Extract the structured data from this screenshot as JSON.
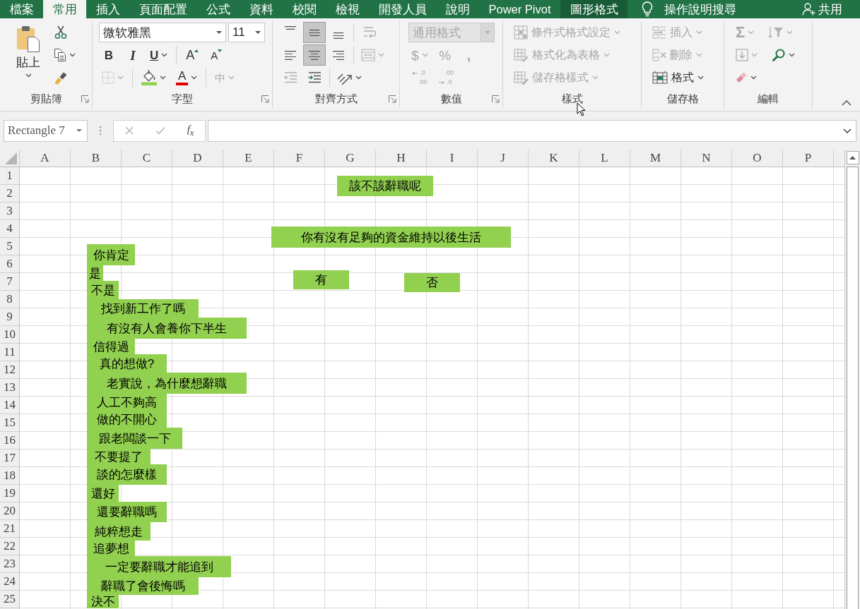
{
  "menu_bar": {
    "tabs": [
      {
        "label": "檔案",
        "kind": "standard",
        "selected": false
      },
      {
        "label": "常用",
        "kind": "standard",
        "selected": true
      },
      {
        "label": "插入",
        "kind": "standard",
        "selected": false
      },
      {
        "label": "頁面配置",
        "kind": "standard",
        "selected": false
      },
      {
        "label": "公式",
        "kind": "standard",
        "selected": false
      },
      {
        "label": "資料",
        "kind": "standard",
        "selected": false
      },
      {
        "label": "校閱",
        "kind": "standard",
        "selected": false
      },
      {
        "label": "檢視",
        "kind": "standard",
        "selected": false
      },
      {
        "label": "開發人員",
        "kind": "standard",
        "selected": false
      },
      {
        "label": "說明",
        "kind": "standard",
        "selected": false
      },
      {
        "label": "Power Pivot",
        "kind": "standard",
        "selected": false
      },
      {
        "label": "圖形格式",
        "kind": "contextual",
        "selected": false
      }
    ],
    "search_label": "操作說明搜尋",
    "share_label": "共用"
  },
  "ribbon": {
    "groups": [
      {
        "kind": "clipboard",
        "label": "剪貼簿",
        "launcher": true,
        "large": {
          "kind": "paste",
          "label": "貼上",
          "caret": true,
          "disabled": false
        },
        "rows": [
          {
            "segments": [
              {
                "tools": [
                  {
                    "kind": "cut",
                    "caret": false,
                    "disabled": false
                  }
                ]
              }
            ]
          },
          {
            "segments": [
              {
                "tools": [
                  {
                    "kind": "copy",
                    "caret": true,
                    "disabled": false
                  }
                ]
              }
            ]
          },
          {
            "segments": [
              {
                "tools": [
                  {
                    "kind": "format-painter",
                    "caret": false,
                    "disabled": false
                  }
                ]
              }
            ]
          }
        ]
      },
      {
        "kind": "font",
        "label": "字型",
        "launcher": true,
        "rows": [
          {
            "segments": [
              {
                "tools": [
                  {
                    "kind": "font-name",
                    "value": "微软雅黑",
                    "disabled": false
                  },
                  {
                    "kind": "font-size",
                    "value": "11",
                    "disabled": false
                  }
                ]
              }
            ]
          },
          {
            "segments": [
              {
                "tools": [
                  {
                    "kind": "bold",
                    "glyph": "B",
                    "caret": false,
                    "disabled": false
                  },
                  {
                    "kind": "italic",
                    "glyph": "I",
                    "caret": false,
                    "disabled": false
                  },
                  {
                    "kind": "underline",
                    "glyph": "U",
                    "caret": true,
                    "disabled": false
                  }
                ]
              },
              {
                "tools": [
                  {
                    "kind": "grow-font",
                    "glyph": "A",
                    "caret": false,
                    "disabled": false
                  },
                  {
                    "kind": "shrink-font",
                    "glyph": "A",
                    "caret": false,
                    "disabled": false
                  }
                ]
              }
            ]
          },
          {
            "segments": [
              {
                "tools": [
                  {
                    "kind": "borders",
                    "caret": true,
                    "disabled": true
                  }
                ]
              },
              {
                "tools": [
                  {
                    "kind": "fill-color",
                    "caret": true,
                    "disabled": false
                  },
                  {
                    "kind": "font-color",
                    "glyph": "A",
                    "caret": true,
                    "disabled": false
                  }
                ]
              },
              {
                "tools": [
                  {
                    "kind": "phonetic",
                    "glyph": "中",
                    "caret": true,
                    "disabled": true
                  }
                ]
              }
            ]
          }
        ]
      },
      {
        "kind": "alignment",
        "label": "對齊方式",
        "launcher": true,
        "rows": [
          {
            "segments": [
              {
                "tools": [
                  {
                    "kind": "align-top",
                    "caret": false,
                    "disabled": false,
                    "selected": false
                  },
                  {
                    "kind": "align-middle",
                    "caret": false,
                    "disabled": false,
                    "selected": true
                  },
                  {
                    "kind": "align-bottom",
                    "caret": false,
                    "disabled": false,
                    "selected": false
                  }
                ]
              },
              {
                "tools": [
                  {
                    "kind": "wrap-text",
                    "caret": false,
                    "disabled": true
                  }
                ]
              }
            ]
          },
          {
            "segments": [
              {
                "tools": [
                  {
                    "kind": "align-left",
                    "caret": false,
                    "disabled": false,
                    "selected": false
                  },
                  {
                    "kind": "align-center",
                    "caret": false,
                    "disabled": false,
                    "selected": true
                  },
                  {
                    "kind": "align-right",
                    "caret": false,
                    "disabled": false,
                    "selected": false
                  }
                ]
              },
              {
                "tools": [
                  {
                    "kind": "merge",
                    "caret": true,
                    "disabled": true
                  }
                ]
              }
            ]
          },
          {
            "segments": [
              {
                "tools": [
                  {
                    "kind": "decrease-indent",
                    "caret": false,
                    "disabled": true
                  },
                  {
                    "kind": "increase-indent",
                    "caret": false,
                    "disabled": false
                  }
                ]
              },
              {
                "tools": [
                  {
                    "kind": "orientation",
                    "caret": true,
                    "disabled": false
                  }
                ]
              }
            ]
          }
        ]
      },
      {
        "kind": "number",
        "label": "數值",
        "launcher": true,
        "rows": [
          {
            "segments": [
              {
                "tools": [
                  {
                    "kind": "number-format",
                    "value": "通用格式",
                    "disabled": true
                  }
                ]
              }
            ]
          },
          {
            "segments": [
              {
                "tools": [
                  {
                    "kind": "currency",
                    "glyph": "$",
                    "caret": true,
                    "disabled": true
                  },
                  {
                    "kind": "percent",
                    "glyph": "%",
                    "caret": false,
                    "disabled": true
                  },
                  {
                    "kind": "comma",
                    "glyph": ",",
                    "caret": false,
                    "disabled": true
                  }
                ]
              }
            ]
          },
          {
            "segments": [
              {
                "tools": [
                  {
                    "kind": "increase-decimal",
                    "lines": [
                      ".0",
                      ".00"
                    ],
                    "caret": false,
                    "disabled": true
                  },
                  {
                    "kind": "decrease-decimal",
                    "lines": [
                      ".00",
                      ".0"
                    ],
                    "caret": false,
                    "disabled": true
                  }
                ]
              }
            ]
          }
        ]
      },
      {
        "kind": "styles",
        "label": "樣式",
        "launcher": false,
        "rows": [
          {
            "segments": [
              {
                "tools": [
                  {
                    "kind": "conditional-format",
                    "label": "條件式格式設定",
                    "caret": true,
                    "disabled": true
                  }
                ]
              }
            ]
          },
          {
            "segments": [
              {
                "tools": [
                  {
                    "kind": "format-as-table",
                    "label": "格式化為表格",
                    "caret": true,
                    "disabled": true
                  }
                ]
              }
            ]
          },
          {
            "segments": [
              {
                "tools": [
                  {
                    "kind": "cell-styles",
                    "label": "儲存格樣式",
                    "caret": true,
                    "disabled": true
                  }
                ]
              }
            ]
          }
        ]
      },
      {
        "kind": "cells",
        "label": "儲存格",
        "launcher": false,
        "rows": [
          {
            "segments": [
              {
                "tools": [
                  {
                    "kind": "insert-cells",
                    "label": "插入",
                    "caret": true,
                    "disabled": true
                  }
                ]
              }
            ]
          },
          {
            "segments": [
              {
                "tools": [
                  {
                    "kind": "delete-cells",
                    "label": "刪除",
                    "caret": true,
                    "disabled": true
                  }
                ]
              }
            ]
          },
          {
            "segments": [
              {
                "tools": [
                  {
                    "kind": "format-cells",
                    "label": "格式",
                    "caret": true,
                    "disabled": false
                  }
                ]
              }
            ]
          }
        ]
      },
      {
        "kind": "editing",
        "label": "編輯",
        "launcher": false,
        "rows": [
          {
            "segments": [
              {
                "tools": [
                  {
                    "kind": "autosum",
                    "glyph": "Σ",
                    "caret": true,
                    "disabled": true
                  },
                  {
                    "kind": "sort-filter",
                    "caret": true,
                    "disabled": true
                  }
                ]
              }
            ]
          },
          {
            "segments": [
              {
                "tools": [
                  {
                    "kind": "fill-down",
                    "caret": true,
                    "disabled": true
                  },
                  {
                    "kind": "find",
                    "caret": true,
                    "disabled": false
                  }
                ]
              }
            ]
          },
          {
            "segments": [
              {
                "tools": [
                  {
                    "kind": "clear",
                    "caret": true,
                    "disabled": false
                  }
                ]
              }
            ]
          }
        ]
      }
    ]
  },
  "formula_bar": {
    "name_box": "Rectangle 7",
    "function_label": "f$_{x}$"
  },
  "sheet": {
    "columns": [
      "A",
      "B",
      "C",
      "D",
      "E",
      "F",
      "G",
      "H",
      "I",
      "J",
      "K",
      "L",
      "M",
      "N",
      "O",
      "P"
    ],
    "rows": [
      "1",
      "2",
      "3",
      "4",
      "5",
      "6",
      "7",
      "8",
      "9",
      "10",
      "11",
      "12",
      "13",
      "14",
      "15",
      "16",
      "17",
      "18",
      "19",
      "20",
      "21",
      "22",
      "23",
      "24",
      "25"
    ],
    "shapes": [
      {
        "text": "該不該辭職呢"
      },
      {
        "text": "你有沒有足夠的資金維持以後生活"
      },
      {
        "text": "有"
      },
      {
        "text": "否"
      },
      {
        "text": "你肯定"
      },
      {
        "text": "是"
      },
      {
        "text": "不是"
      },
      {
        "text": "找到新工作了嗎"
      },
      {
        "text": "有沒有人會養你下半生"
      },
      {
        "text": "信得過"
      },
      {
        "text": "真的想做?"
      },
      {
        "text": "老實說，為什麼想辭職"
      },
      {
        "text": "人工不夠高"
      },
      {
        "text": "做的不開心"
      },
      {
        "text": "跟老闆談一下"
      },
      {
        "text": "不要提了"
      },
      {
        "text": "談的怎麼樣"
      },
      {
        "text": "還好"
      },
      {
        "text": "還要辭職嗎"
      },
      {
        "text": "純粹想走"
      },
      {
        "text": "追夢想"
      },
      {
        "text": "一定要辭職才能追到"
      },
      {
        "text": "辭職了會後悔嗎"
      },
      {
        "text": "決不"
      }
    ]
  }
}
